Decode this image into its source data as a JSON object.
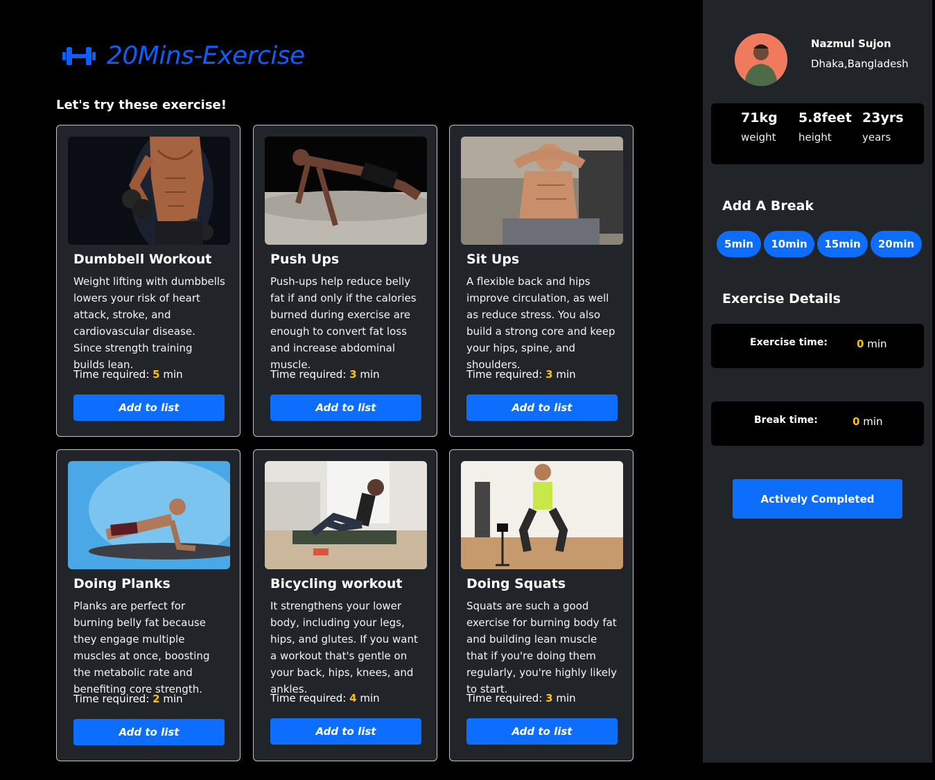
{
  "app": {
    "logo_text": "20Mins-Exercise",
    "subtitle": "Let's try these exercise!"
  },
  "exercises": [
    {
      "title": "Dumbbell Workout",
      "description": "Weight lifting with dumbbells lowers your risk of heart attack, stroke, and cardiovascular disease. Since strength training builds lean.",
      "time_label": "Time required:",
      "time_value": "5",
      "time_unit": "min",
      "button_label": "Add to list",
      "image_icon": "dumbbell-workout-image"
    },
    {
      "title": "Push Ups",
      "description": "Push-ups help reduce belly fat if and only if the calories burned during exercise are enough to convert fat loss and increase abdominal muscle.",
      "time_label": "Time required:",
      "time_value": "3",
      "time_unit": "min",
      "button_label": "Add to list",
      "image_icon": "push-ups-image"
    },
    {
      "title": "Sit Ups",
      "description": "A flexible back and hips improve circulation, as well as reduce stress. You also build a strong core and keep your hips, spine, and shoulders.",
      "time_label": "Time required:",
      "time_value": "3",
      "time_unit": "min",
      "button_label": "Add to list",
      "image_icon": "sit-ups-image"
    },
    {
      "title": "Doing Planks",
      "description": "Planks are perfect for burning belly fat because they engage multiple muscles at once, boosting the metabolic rate and benefiting core strength.",
      "time_label": "Time required:",
      "time_value": "2",
      "time_unit": "min",
      "button_label": "Add to list",
      "image_icon": "planks-image"
    },
    {
      "title": "Bicycling workout",
      "description": "It strengthens your lower body, including your legs, hips, and glutes. If you want a workout that's gentle on your back, hips, knees, and ankles.",
      "time_label": "Time required:",
      "time_value": "4",
      "time_unit": "min",
      "button_label": "Add to list",
      "image_icon": "bicycling-image"
    },
    {
      "title": "Doing Squats",
      "description": "Squats are such a good exercise for burning body fat and building lean muscle that if you're doing them regularly, you're highly likely to start.",
      "time_label": "Time required:",
      "time_value": "3",
      "time_unit": "min",
      "button_label": "Add to list",
      "image_icon": "squats-image"
    }
  ],
  "profile": {
    "name": "Nazmul Sujon",
    "location": "Dhaka,Bangladesh",
    "stats": [
      {
        "value": "71kg",
        "label": "weight"
      },
      {
        "value": "5.8feet",
        "label": "height"
      },
      {
        "value": "23yrs",
        "label": "years"
      }
    ]
  },
  "break_section": {
    "heading": "Add A Break",
    "options": [
      "5min",
      "10min",
      "15min",
      "20min"
    ]
  },
  "details": {
    "heading": "Exercise Details",
    "exercise_time_label": "Exercise time:",
    "exercise_time_value": "0",
    "break_time_label": "Break time:",
    "break_time_value": "0",
    "unit": "min"
  },
  "complete_button": "Actively Completed",
  "colors": {
    "accent": "#0d6efd",
    "highlight": "#ffc107",
    "panel": "#212529",
    "background": "#000000"
  }
}
